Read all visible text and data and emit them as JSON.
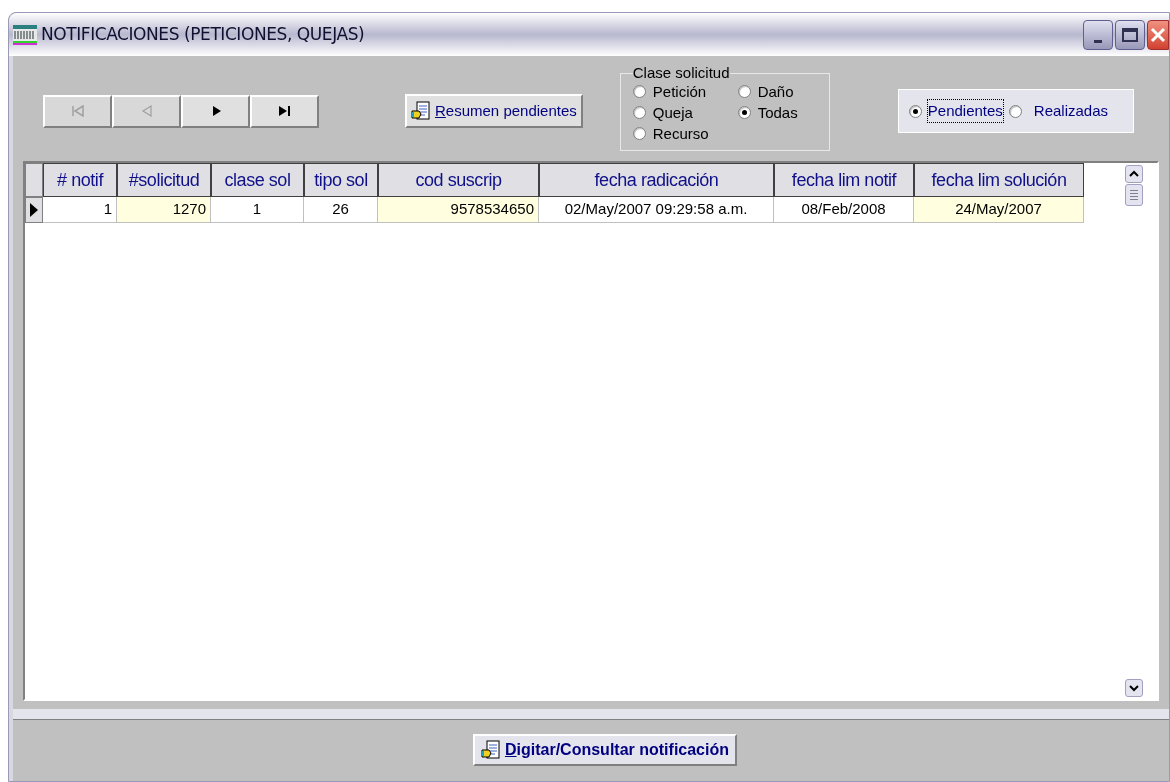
{
  "window": {
    "title": "NOTIFICACIONES (PETICIONES, QUEJAS)"
  },
  "nav_buttons": [
    {
      "kind": "first",
      "disabled": true
    },
    {
      "kind": "prev",
      "disabled": true
    },
    {
      "kind": "next",
      "disabled": false
    },
    {
      "kind": "last",
      "disabled": false
    }
  ],
  "summary_button": {
    "label": "Resumen pendientes"
  },
  "clase_solicitud": {
    "title": "Clase solicitud",
    "options": [
      {
        "label": "Petición",
        "selected": false
      },
      {
        "label": "Daño",
        "selected": false
      },
      {
        "label": "Queja",
        "selected": false
      },
      {
        "label": "Todas",
        "selected": true
      },
      {
        "label": "Recurso",
        "selected": false
      }
    ]
  },
  "status_filter": [
    {
      "label": "Pendientes",
      "selected": true
    },
    {
      "label": "Realizadas",
      "selected": false
    }
  ],
  "table": {
    "columns": [
      {
        "label": "# notif",
        "highlighted": false,
        "kind": "right"
      },
      {
        "label": "#solicitud",
        "highlighted": true,
        "kind": "right"
      },
      {
        "label": "clase sol",
        "highlighted": false,
        "kind": "center"
      },
      {
        "label": "tipo sol",
        "highlighted": false,
        "kind": "center"
      },
      {
        "label": "cod suscrip",
        "highlighted": true,
        "kind": "right"
      },
      {
        "label": "fecha radicación",
        "highlighted": false,
        "kind": "center"
      },
      {
        "label": "fecha lim notif",
        "highlighted": false,
        "kind": "center"
      },
      {
        "label": "fecha lim solución",
        "highlighted": true,
        "kind": "center"
      }
    ],
    "rows": [
      {
        "current": true,
        "cells": [
          "1",
          "1270",
          "1",
          "26",
          "9578534650",
          "02/May/2007 09:29:58 a.m.",
          "08/Feb/2008",
          "24/May/2007"
        ]
      }
    ]
  },
  "action_button": {
    "label": "Digitar/Consultar notificación"
  }
}
